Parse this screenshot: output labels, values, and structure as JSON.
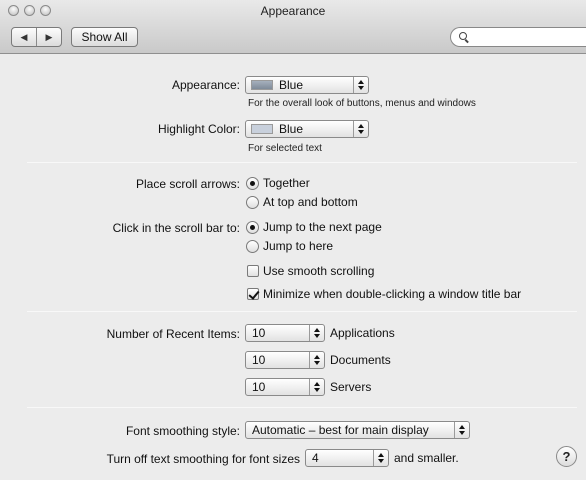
{
  "window": {
    "title": "Appearance"
  },
  "toolbar": {
    "back_icon": "triangle-left",
    "forward_icon": "triangle-right",
    "show_all_label": "Show All",
    "search_placeholder": ""
  },
  "appearance": {
    "label": "Appearance:",
    "value": "Blue",
    "swatch_color": "#8e9aa8",
    "caption": "For the overall look of buttons, menus and windows"
  },
  "highlight": {
    "label": "Highlight Color:",
    "value": "Blue",
    "swatch_color": "#c8d0dc",
    "caption": "For selected text"
  },
  "scroll_arrows": {
    "label": "Place scroll arrows:",
    "options": [
      {
        "label": "Together",
        "selected": true
      },
      {
        "label": "At top and bottom",
        "selected": false
      }
    ]
  },
  "scroll_click": {
    "label": "Click in the scroll bar to:",
    "options": [
      {
        "label": "Jump to the next page",
        "selected": true
      },
      {
        "label": "Jump to here",
        "selected": false
      }
    ]
  },
  "checkboxes": [
    {
      "label": "Use smooth scrolling",
      "checked": false
    },
    {
      "label": "Minimize when double-clicking a window title bar",
      "checked": true
    }
  ],
  "recent_items": {
    "label": "Number of Recent Items:",
    "rows": [
      {
        "value": "10",
        "label": "Applications"
      },
      {
        "value": "10",
        "label": "Documents"
      },
      {
        "value": "10",
        "label": "Servers"
      }
    ]
  },
  "font_smoothing": {
    "label": "Font smoothing style:",
    "value": "Automatic – best for main display"
  },
  "text_smoothing": {
    "prefix": "Turn off text smoothing for font sizes",
    "value": "4",
    "suffix": "and smaller."
  },
  "help": {
    "label": "?"
  }
}
